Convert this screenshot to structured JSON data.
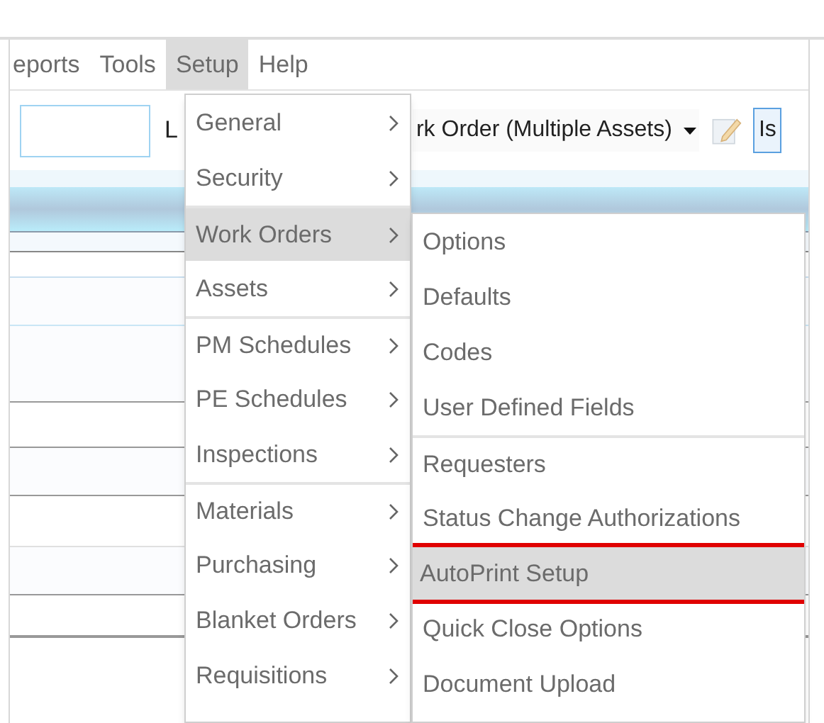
{
  "menubar": [
    {
      "label": "eports",
      "selected": false
    },
    {
      "label": "Tools",
      "selected": false
    },
    {
      "label": "Setup",
      "selected": true
    },
    {
      "label": "Help",
      "selected": false
    }
  ],
  "toolbar": {
    "label": "L",
    "dropdown": {
      "value": "rk Order (Multiple Assets)"
    },
    "field": {
      "value": "Is"
    }
  },
  "setup_menu": [
    {
      "label": "General",
      "selected": false,
      "separator_before": false
    },
    {
      "label": "Security",
      "selected": false,
      "separator_before": false
    },
    {
      "label": "Work Orders",
      "selected": true,
      "separator_before": true
    },
    {
      "label": "Assets",
      "selected": false,
      "separator_before": false
    },
    {
      "label": "PM Schedules",
      "selected": false,
      "separator_before": true
    },
    {
      "label": "PE Schedules",
      "selected": false,
      "separator_before": false
    },
    {
      "label": "Inspections",
      "selected": false,
      "separator_before": false
    },
    {
      "label": "Materials",
      "selected": false,
      "separator_before": true
    },
    {
      "label": "Purchasing",
      "selected": false,
      "separator_before": false
    },
    {
      "label": "Blanket Orders",
      "selected": false,
      "separator_before": false
    },
    {
      "label": "Requisitions",
      "selected": false,
      "separator_before": false
    }
  ],
  "work_orders_submenu": [
    {
      "label": "Options",
      "selected": false,
      "outlined": false,
      "separator_before": false
    },
    {
      "label": "Defaults",
      "selected": false,
      "outlined": false,
      "separator_before": false
    },
    {
      "label": "Codes",
      "selected": false,
      "outlined": false,
      "separator_before": false
    },
    {
      "label": "User Defined Fields",
      "selected": false,
      "outlined": false,
      "separator_before": false
    },
    {
      "label": "Requesters",
      "selected": false,
      "outlined": false,
      "separator_before": true
    },
    {
      "label": "Status Change Authorizations",
      "selected": false,
      "outlined": false,
      "separator_before": false
    },
    {
      "label": "AutoPrint Setup",
      "selected": true,
      "outlined": true,
      "separator_before": false
    },
    {
      "label": "Quick Close Options",
      "selected": false,
      "outlined": false,
      "separator_before": false
    },
    {
      "label": "Document Upload",
      "selected": false,
      "outlined": false,
      "separator_before": false
    }
  ]
}
